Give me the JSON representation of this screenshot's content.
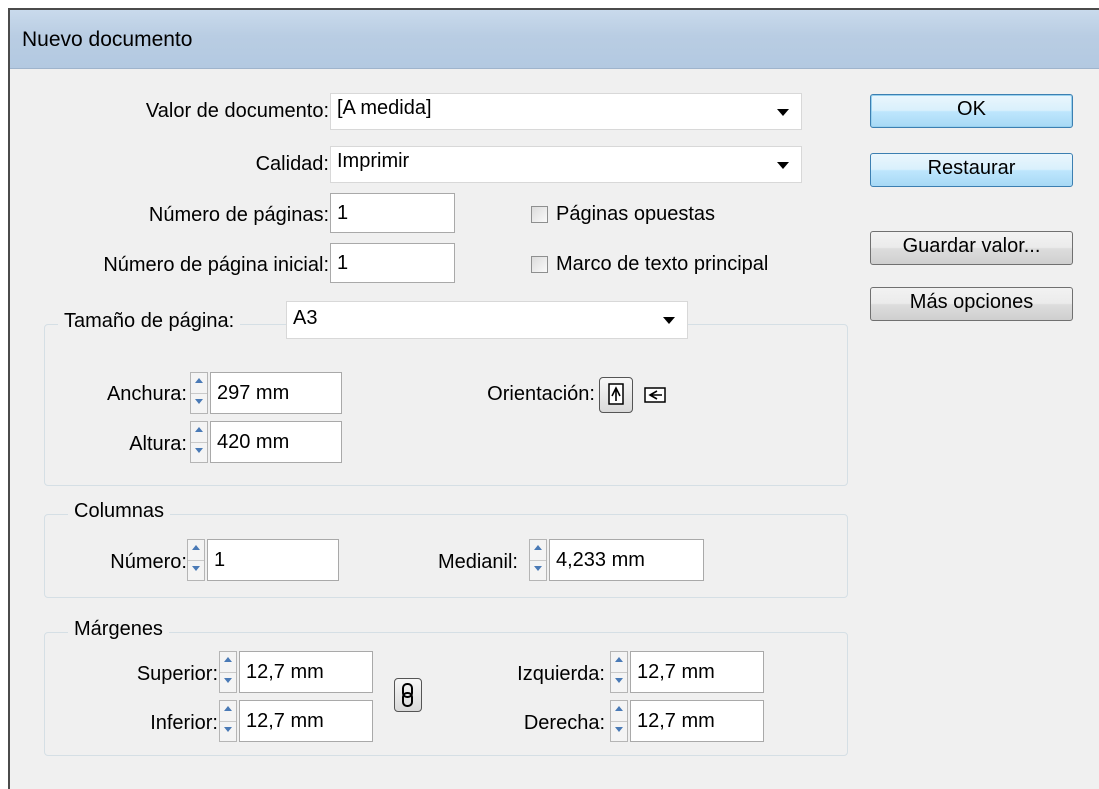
{
  "dialog": {
    "title": "Nuevo documento"
  },
  "preset": {
    "label": "Valor de documento:",
    "value": "[A medida]"
  },
  "intent": {
    "label": "Calidad:",
    "value": "Imprimir"
  },
  "pages": {
    "label": "Número de páginas:",
    "value": "1"
  },
  "start_page": {
    "label": "Número de página inicial:",
    "value": "1"
  },
  "facing_pages": {
    "label": "Páginas opuestas",
    "checked": false
  },
  "master_text_frame": {
    "label": "Marco de texto principal",
    "checked": false
  },
  "page_size": {
    "label": "Tamaño de página:",
    "value": "A3",
    "width_label": "Anchura:",
    "width": "297 mm",
    "height_label": "Altura:",
    "height": "420 mm",
    "orientation_label": "Orientación:",
    "orientation_selected": "portrait"
  },
  "columns": {
    "legend": "Columnas",
    "number_label": "Número:",
    "number": "1",
    "gutter_label": "Medianil:",
    "gutter": "4,233 mm"
  },
  "margins": {
    "legend": "Márgenes",
    "top_label": "Superior:",
    "top": "12,7 mm",
    "bottom_label": "Inferior:",
    "bottom": "12,7 mm",
    "left_label": "Izquierda:",
    "left": "12,7 mm",
    "right_label": "Derecha:",
    "right": "12,7 mm",
    "link_icon": "chain-link-icon"
  },
  "buttons": {
    "ok": "OK",
    "reset": "Restaurar",
    "save_preset": "Guardar valor...",
    "more_options": "Más opciones"
  }
}
